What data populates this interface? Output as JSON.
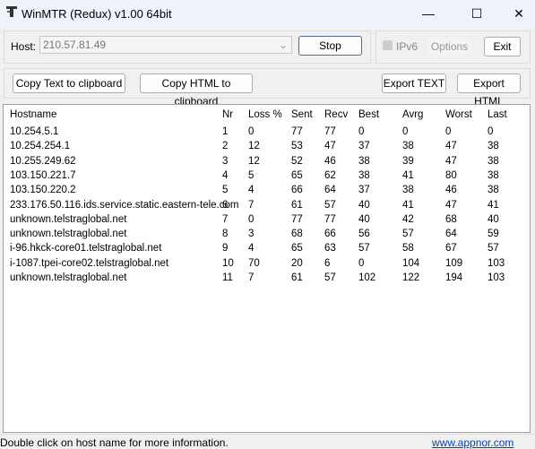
{
  "window": {
    "title": "WinMTR (Redux) v1.00 64bit",
    "minimize": "—",
    "maximize": "☐",
    "close": "✕"
  },
  "host": {
    "label": "Host:",
    "value": "210.57.81.49",
    "stop_label": "Stop"
  },
  "options": {
    "ipv6_label": "IPv6",
    "ipv6_checked": false,
    "options_label": "Options",
    "exit_label": "Exit"
  },
  "toolbar": {
    "copy_text": "Copy Text to clipboard",
    "copy_html": "Copy HTML to clipboard",
    "export_text": "Export TEXT",
    "export_html": "Export HTML"
  },
  "table": {
    "columns": [
      "Hostname",
      "Nr",
      "Loss %",
      "Sent",
      "Recv",
      "Best",
      "Avrg",
      "Worst",
      "Last"
    ],
    "rows": [
      [
        "10.254.5.1",
        "1",
        "0",
        "77",
        "77",
        "0",
        "0",
        "0",
        "0"
      ],
      [
        "10.254.254.1",
        "2",
        "12",
        "53",
        "47",
        "37",
        "38",
        "47",
        "38"
      ],
      [
        "10.255.249.62",
        "3",
        "12",
        "52",
        "46",
        "38",
        "39",
        "47",
        "38"
      ],
      [
        "103.150.221.7",
        "4",
        "5",
        "65",
        "62",
        "38",
        "41",
        "80",
        "38"
      ],
      [
        "103.150.220.2",
        "5",
        "4",
        "66",
        "64",
        "37",
        "38",
        "46",
        "38"
      ],
      [
        "233.176.50.116.ids.service.static.eastern-tele.com",
        "6",
        "7",
        "61",
        "57",
        "40",
        "41",
        "47",
        "41"
      ],
      [
        "unknown.telstraglobal.net",
        "7",
        "0",
        "77",
        "77",
        "40",
        "42",
        "68",
        "40"
      ],
      [
        "unknown.telstraglobal.net",
        "8",
        "3",
        "68",
        "66",
        "56",
        "57",
        "64",
        "59"
      ],
      [
        "i-96.hkck-core01.telstraglobal.net",
        "9",
        "4",
        "65",
        "63",
        "57",
        "58",
        "67",
        "57"
      ],
      [
        "i-1087.tpei-core02.telstraglobal.net",
        "10",
        "70",
        "20",
        "6",
        "0",
        "104",
        "109",
        "103"
      ],
      [
        "unknown.telstraglobal.net",
        "11",
        "7",
        "61",
        "57",
        "102",
        "122",
        "194",
        "103"
      ]
    ]
  },
  "status": {
    "message": "Double click on host name for more information.",
    "link": "www.appnor.com",
    "link_color": "#0645ad"
  }
}
